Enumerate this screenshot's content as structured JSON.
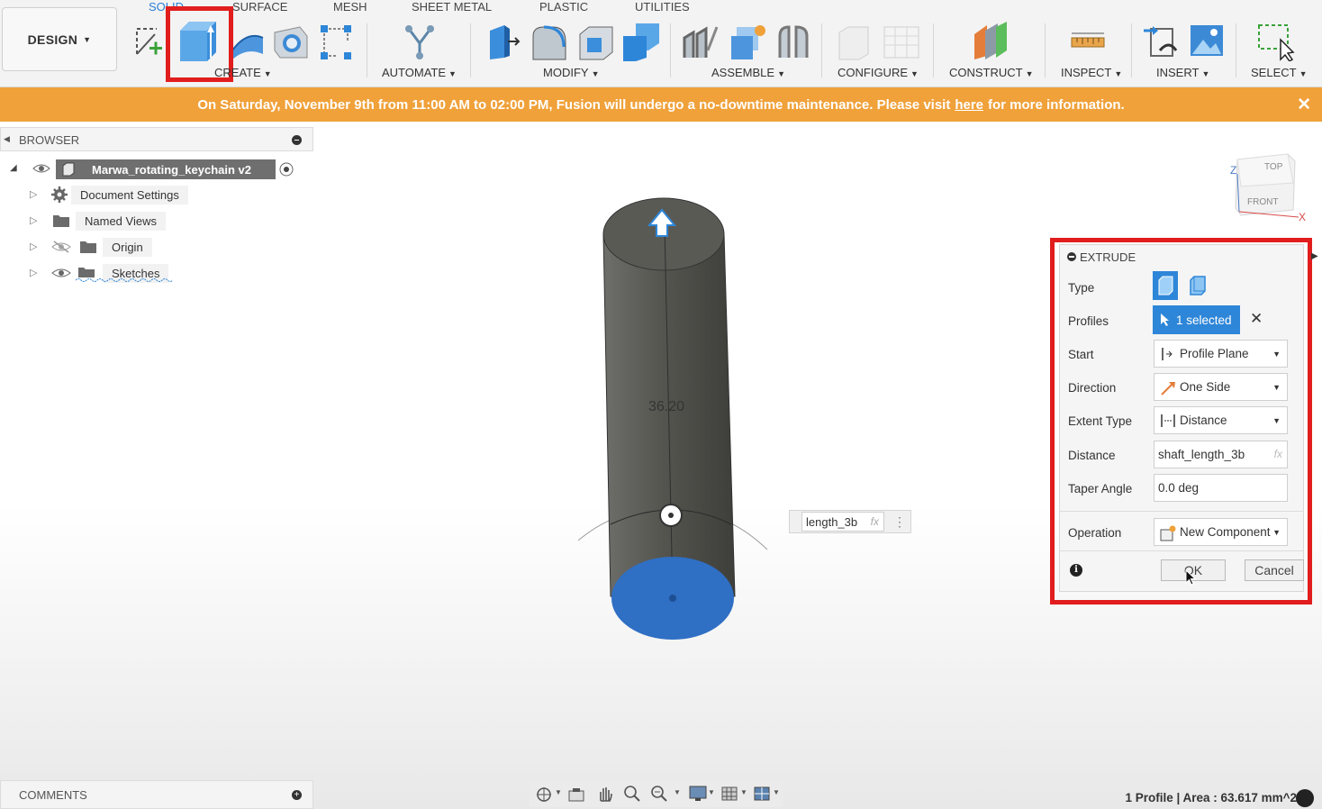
{
  "workspace_button": "DESIGN",
  "tabs": [
    "SOLID",
    "SURFACE",
    "MESH",
    "SHEET METAL",
    "PLASTIC",
    "UTILITIES"
  ],
  "groups": {
    "create": "CREATE",
    "automate": "AUTOMATE",
    "modify": "MODIFY",
    "assemble": "ASSEMBLE",
    "configure": "CONFIGURE",
    "construct": "CONSTRUCT",
    "inspect": "INSPECT",
    "insert": "INSERT",
    "select": "SELECT"
  },
  "banner": {
    "text_before": "On Saturday, November 9th from 11:00 AM to 02:00 PM, Fusion will undergo a no-downtime maintenance. Please visit",
    "link": "here",
    "text_after": "for more information.",
    "close": "✕"
  },
  "browser": {
    "title": "BROWSER",
    "root": "Marwa_rotating_keychain v2",
    "items": [
      "Document Settings",
      "Named Views",
      "Origin",
      "Sketches"
    ]
  },
  "comments": {
    "title": "COMMENTS"
  },
  "viewport": {
    "dimension_value": "36.20",
    "dimension_input": "length_3b",
    "fx": "fx",
    "viewcube_top": "TOP",
    "viewcube_front": "FRONT",
    "axis_z": "Z",
    "axis_x": "X"
  },
  "extrude": {
    "title": "EXTRUDE",
    "labels": {
      "type": "Type",
      "profiles": "Profiles",
      "start": "Start",
      "direction": "Direction",
      "extent_type": "Extent Type",
      "distance": "Distance",
      "taper_angle": "Taper Angle",
      "operation": "Operation"
    },
    "profiles_value": "1 selected",
    "start_value": "Profile Plane",
    "direction_value": "One Side",
    "extent_type_value": "Distance",
    "distance_value": "shaft_length_3b",
    "distance_fx": "fx",
    "taper_angle_value": "0.0 deg",
    "operation_value": "New Component",
    "ok": "OK",
    "cancel": "Cancel"
  },
  "status": "1 Profile | Area : 63.617 mm^2",
  "colors": {
    "accent": "#2e86d8",
    "banner": "#f0a13a",
    "highlight": "#e11d1d",
    "profile_face": "#2f6fc4",
    "body": "#4e4e4b"
  }
}
